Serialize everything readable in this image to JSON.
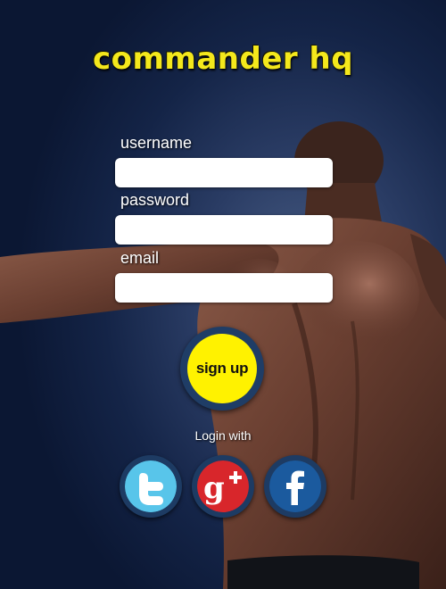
{
  "app": {
    "title": "commander hq"
  },
  "form": {
    "username_label": "username",
    "username_value": "",
    "password_label": "password",
    "password_value": "",
    "email_label": "email",
    "email_value": "",
    "signup_label": "sign up"
  },
  "social": {
    "heading": "Login with",
    "providers": [
      {
        "name": "twitter-icon",
        "color": "#58c5ea"
      },
      {
        "name": "google-plus-icon",
        "color": "#d8262b"
      },
      {
        "name": "facebook-icon",
        "color": "#1b5a9e"
      }
    ]
  },
  "colors": {
    "accent": "#fff200",
    "title": "#f4e81c",
    "background": "#142447"
  }
}
